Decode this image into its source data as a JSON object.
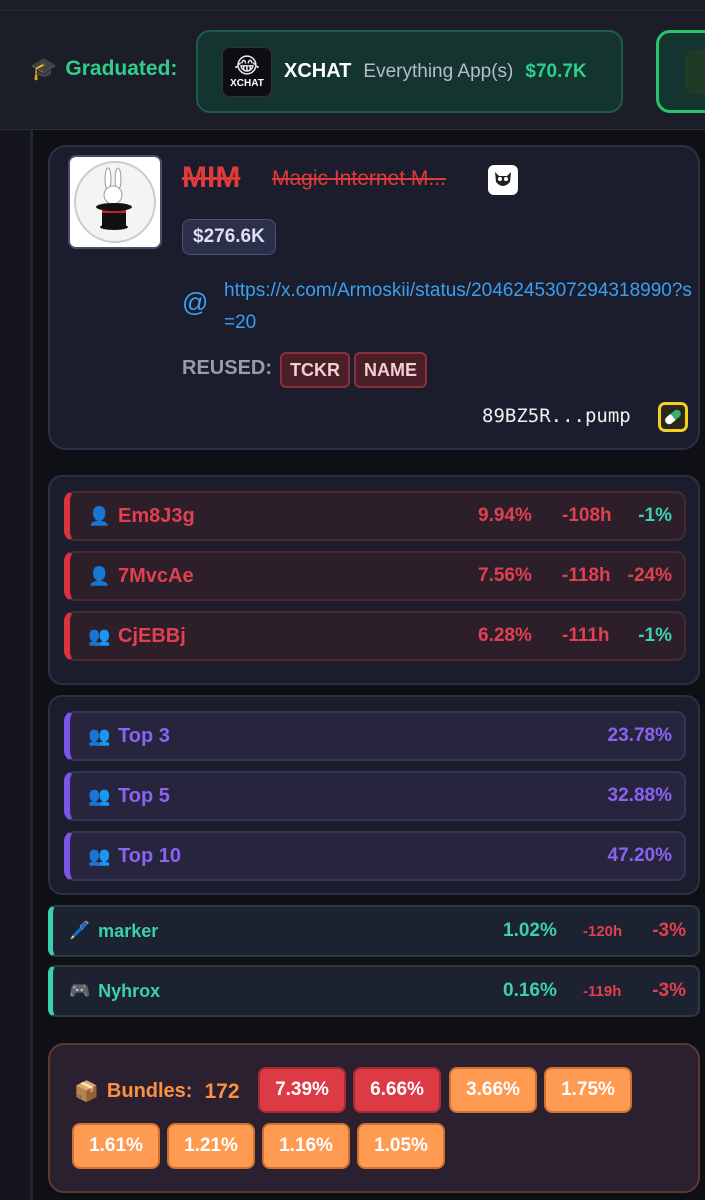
{
  "graduated": {
    "label": "Graduated:",
    "cards": [
      {
        "logo_text": "XCHAT",
        "symbol": "XCHAT",
        "name": "Everything App(s)",
        "mcap": "$70.7K"
      }
    ]
  },
  "token": {
    "ticker": "MIM",
    "name": "Magic Internet M...",
    "mcap": "$276.6K",
    "link": "https://x.com/Armoskii/status/2046245307294318990?s=20",
    "reused_label": "REUSED:",
    "reused_tags": [
      "TCKR",
      "NAME"
    ],
    "address": "89BZ5R...pump",
    "icons": {
      "owl": "owl-icon",
      "link": "at-icon",
      "pill": "pill-icon"
    }
  },
  "holders": [
    {
      "id": "Em8J3g",
      "icon": "user-icon",
      "pct": "9.94%",
      "age": "-108h",
      "change": "-1%",
      "change_color": "#3ad0b0"
    },
    {
      "id": "7MvcAe",
      "icon": "user-icon",
      "pct": "7.56%",
      "age": "-118h",
      "change": "-24%",
      "change_color": "#e04050"
    },
    {
      "id": "CjEBBj",
      "icon": "users-icon",
      "pct": "6.28%",
      "age": "-111h",
      "change": "-1%",
      "change_color": "#3ad0b0"
    }
  ],
  "tops": [
    {
      "label": "Top 3",
      "pct": "23.78%"
    },
    {
      "label": "Top 5",
      "pct": "32.88%"
    },
    {
      "label": "Top 10",
      "pct": "47.20%"
    }
  ],
  "wallets": [
    {
      "icon": "pen-icon",
      "label": "marker",
      "pct": "1.02%",
      "age": "-120h",
      "change": "-3%"
    },
    {
      "icon": "gamepad-icon",
      "label": "Nyhrox",
      "pct": "0.16%",
      "age": "-119h",
      "change": "-3%"
    }
  ],
  "bundles": {
    "label": "Bundles:",
    "count": "172",
    "values": [
      "7.39%",
      "6.66%",
      "3.66%",
      "1.75%",
      "1.61%",
      "1.21%",
      "1.16%",
      "1.05%"
    ]
  }
}
